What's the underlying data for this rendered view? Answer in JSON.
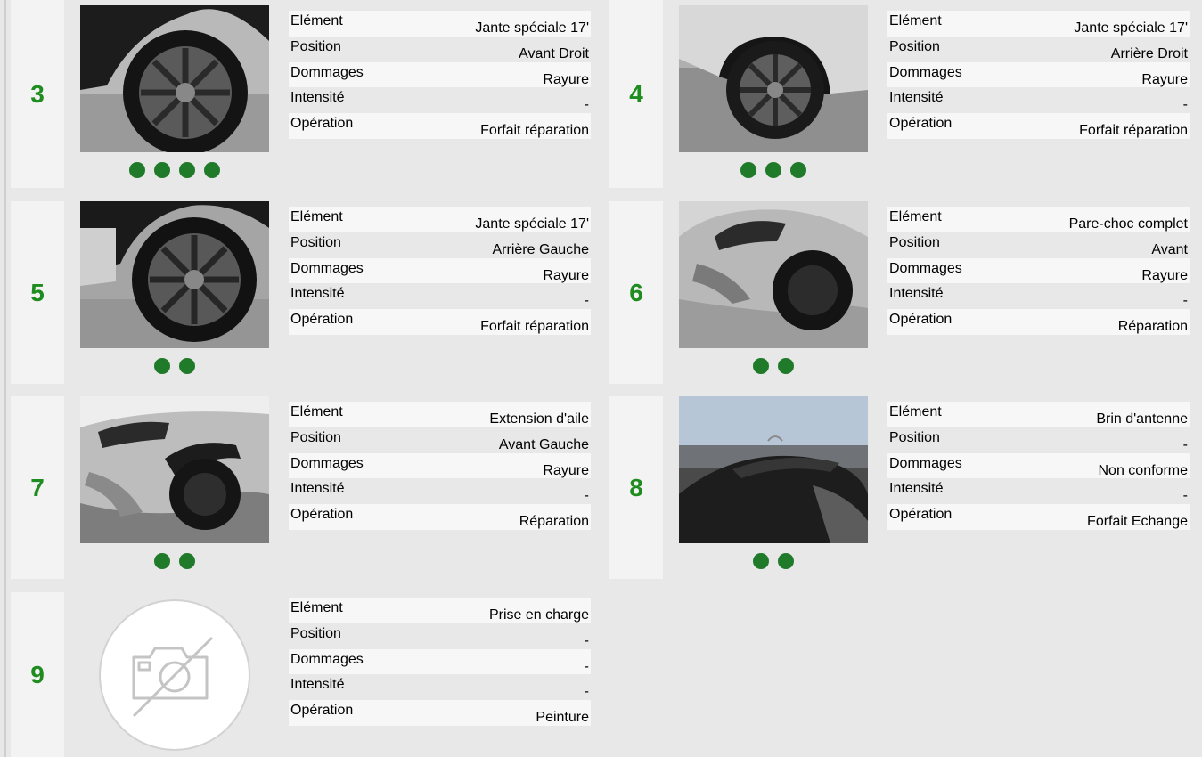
{
  "row_labels": {
    "element": "Elément",
    "position": "Position",
    "dommages": "Dommages",
    "intensite": "Intensité",
    "operation": "Opération"
  },
  "items": [
    {
      "num": "3",
      "photo_icon": "wheel-front-right-photo",
      "dots": 4,
      "element": "Jante spéciale 17'",
      "position": "Avant Droit",
      "dommages": "Rayure",
      "intensite": "-",
      "operation": "Forfait réparation"
    },
    {
      "num": "4",
      "photo_icon": "wheel-rear-right-photo",
      "dots": 3,
      "element": "Jante spéciale 17'",
      "position": "Arrière Droit",
      "dommages": "Rayure",
      "intensite": "-",
      "operation": "Forfait réparation"
    },
    {
      "num": "5",
      "photo_icon": "wheel-rear-left-photo",
      "dots": 2,
      "element": "Jante spéciale 17'",
      "position": "Arrière Gauche",
      "dommages": "Rayure",
      "intensite": "-",
      "operation": "Forfait réparation"
    },
    {
      "num": "6",
      "photo_icon": "front-bumper-photo",
      "dots": 2,
      "element": "Pare-choc complet",
      "position": "Avant",
      "dommages": "Rayure",
      "intensite": "-",
      "operation": "Réparation"
    },
    {
      "num": "7",
      "photo_icon": "wing-extension-photo",
      "dots": 2,
      "element": "Extension d'aile",
      "position": "Avant Gauche",
      "dommages": "Rayure",
      "intensite": "-",
      "operation": "Réparation"
    },
    {
      "num": "8",
      "photo_icon": "roof-antenna-photo",
      "dots": 2,
      "element": "Brin d'antenne",
      "position": "-",
      "dommages": "Non conforme",
      "intensite": "-",
      "operation": "Forfait Echange"
    },
    {
      "num": "9",
      "photo_icon": "no-photo-icon",
      "dots": 0,
      "element": "Prise en charge",
      "position": "-",
      "dommages": "-",
      "intensite": "-",
      "operation": "Peinture"
    }
  ],
  "colors": {
    "accent": "#1f8c1f",
    "dot": "#1f7a2a",
    "page_bg": "#e8e8e8"
  }
}
